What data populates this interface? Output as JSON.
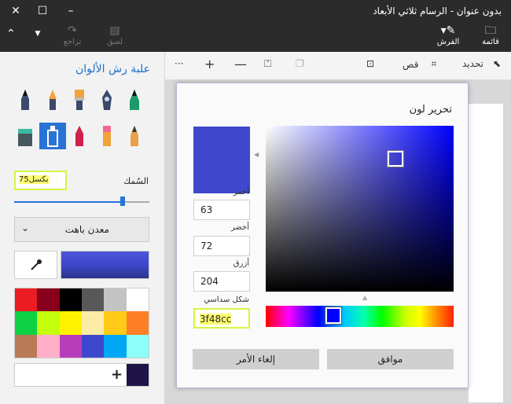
{
  "window": {
    "title": "بدون عنوان - الرسام ثلاثي الأبعاد",
    "minimize_glyph": "–",
    "maximize_glyph": "☐",
    "close_glyph": "✕"
  },
  "ribbon": {
    "menu_label": "قائمة",
    "brushes_label": "الفرش",
    "redo_label": "تراجع",
    "paste_label": "لصق"
  },
  "toolbar": {
    "select_label": "تحديد",
    "crop_label": "قص",
    "more_label": "···"
  },
  "panel": {
    "title": "علبة رش الألوان",
    "thickness_label": "السُمك",
    "thickness_value": "75بكسل",
    "thickness_fraction": 0.8,
    "material_value": "معدن باهت",
    "current_color": "#3f48cc",
    "swatches": [
      "#ffffff",
      "#c3c3c3",
      "#585858",
      "#000000",
      "#88001b",
      "#ec1c24",
      "#ff7f27",
      "#ffca18",
      "#fdeca6",
      "#fff200",
      "#c4ff0e",
      "#0ed145",
      "#8cfffb",
      "#00a8f3",
      "#3f48cc",
      "#b83dba",
      "#ffaec8",
      "#b97a56"
    ],
    "custom_swatch": "#1e1448"
  },
  "dialog": {
    "title": "تحرير لون",
    "red_label": "أحمر",
    "red_value": "63",
    "green_label": "أخضر",
    "green_value": "72",
    "blue_label": "أزرق",
    "blue_value": "204",
    "hex_label": "شكل سداسي",
    "hex_value": "3f48cc",
    "ok_label": "موافق",
    "cancel_label": "إلغاء الأمر",
    "color": "#3f48cc",
    "saturation": 0.69,
    "value": 0.8,
    "hue_position": 0.36
  }
}
